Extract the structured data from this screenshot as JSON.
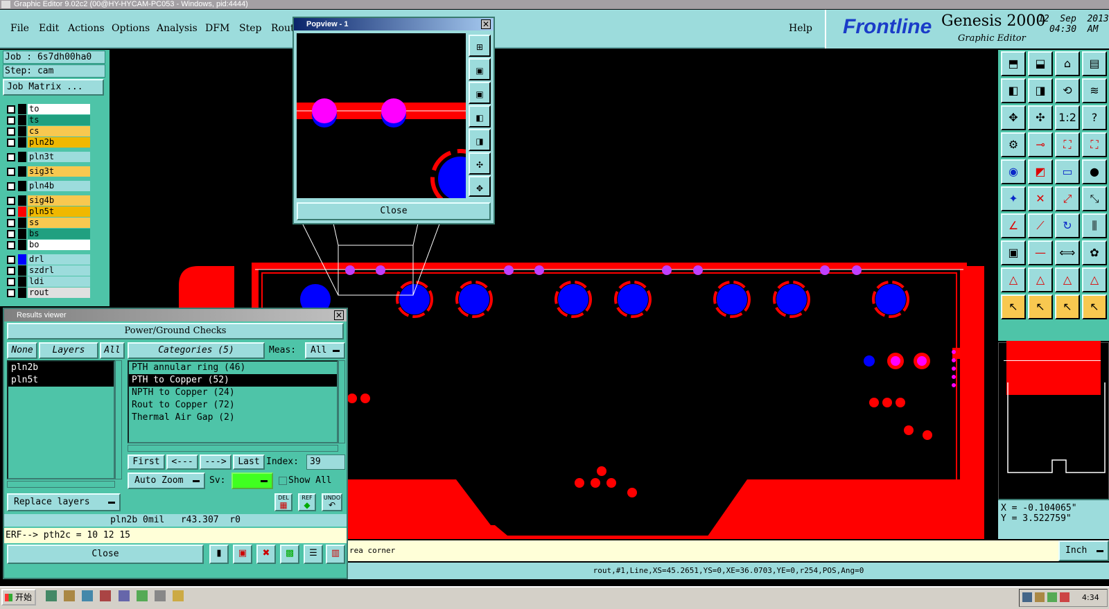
{
  "window": {
    "title": "Graphic Editor 9.02c2 (00@HY-HYCAM-PC053 - Windows, pid:4444)"
  },
  "menu": [
    "File",
    "Edit",
    "Actions",
    "Options",
    "Analysis",
    "DFM",
    "Step",
    "Rout"
  ],
  "help_label": "Help",
  "brand": {
    "logo": "Frontline",
    "product": "Genesis 2000",
    "subtitle": "Graphic Editor",
    "date": "12  Sep  2013",
    "time": "04:30  AM"
  },
  "job": {
    "job_label": "Job : 6s7dh00ha0",
    "step_label": "Step: cam",
    "matrix_button": "Job Matrix ..."
  },
  "layers": [
    {
      "name": "to",
      "color": "#ffffff",
      "swatch": "#000000"
    },
    {
      "name": "ts",
      "color": "#20a080",
      "swatch": "#000000"
    },
    {
      "name": "cs",
      "color": "#f8c850",
      "swatch": "#000000"
    },
    {
      "name": "pln2b",
      "color": "#f0b800",
      "swatch": "#000000"
    },
    {
      "name": "pln3t",
      "color": "#9cdcdc",
      "swatch": "#000000"
    },
    {
      "name": "sig3t",
      "color": "#f8c850",
      "swatch": "#000000"
    },
    {
      "name": "pln4b",
      "color": "#9cdcdc",
      "swatch": "#000000"
    },
    {
      "name": "sig4b",
      "color": "#f8c850",
      "swatch": "#000000"
    },
    {
      "name": "pln5t",
      "color": "#f0b800",
      "swatch": "#ff0000"
    },
    {
      "name": "ss",
      "color": "#f8c850",
      "swatch": "#000000"
    },
    {
      "name": "bs",
      "color": "#20a080",
      "swatch": "#000000"
    },
    {
      "name": "bo",
      "color": "#ffffff",
      "swatch": "#000000"
    },
    {
      "name": "drl",
      "color": "#9cdcdc",
      "swatch": "#0000ff"
    },
    {
      "name": "szdrl",
      "color": "#9cdcdc",
      "swatch": "#000000"
    },
    {
      "name": "ldi",
      "color": "#9cdcdc",
      "swatch": "#000000"
    },
    {
      "name": "rout",
      "color": "#e0e0e0",
      "swatch": "#000000"
    }
  ],
  "popview": {
    "title": "Popview - 1",
    "close_label": "Close"
  },
  "results": {
    "title": "Results viewer",
    "section": "Power/Ground Checks",
    "none_label": "None",
    "layers_label": "Layers",
    "all_label": "All",
    "categories_label": "Categories (5)",
    "meas_label": "Meas:",
    "meas_value": "All",
    "layer_items": [
      "pln2b",
      "pln5t"
    ],
    "category_items": [
      "PTH annular ring (46)",
      "PTH to Copper (52)",
      "NPTH to Copper (24)",
      "Rout to Copper (72)",
      "Thermal Air Gap (2)"
    ],
    "selected_category": 1,
    "nav": {
      "first": "First",
      "prev": "<---",
      "next": "--->",
      "last": "Last",
      "index_label": "Index:",
      "index_value": "39"
    },
    "zoom_label": "Auto Zoom",
    "sv_label": "Sv:",
    "show_all_label": "Show All",
    "replace_label": "Replace layers",
    "del_label": "DEL",
    "ref_label": "REF",
    "undo_label": "UNDO",
    "info_line": "pln2b 0mil   r43.307  r0",
    "erf_line": "ERF--> pth2c = 10 12 15",
    "close_label": "Close"
  },
  "coords": {
    "x": "X = -0.104065\"",
    "y": "Y = 3.522759\""
  },
  "units_label": "Inch",
  "message": "rea corner",
  "status": "rout,#1,Line,XS=45.2651,YS=0,XE=36.0703,YE=0,r254,POS,Ang=0",
  "taskbar": {
    "start": "开始",
    "clock": "4:34"
  },
  "colors": {
    "panel": "#4ec4a8",
    "light": "#9cdcdc",
    "copper": "#ff0000",
    "drill": "#0000ff",
    "pad": "#ff00ff"
  }
}
